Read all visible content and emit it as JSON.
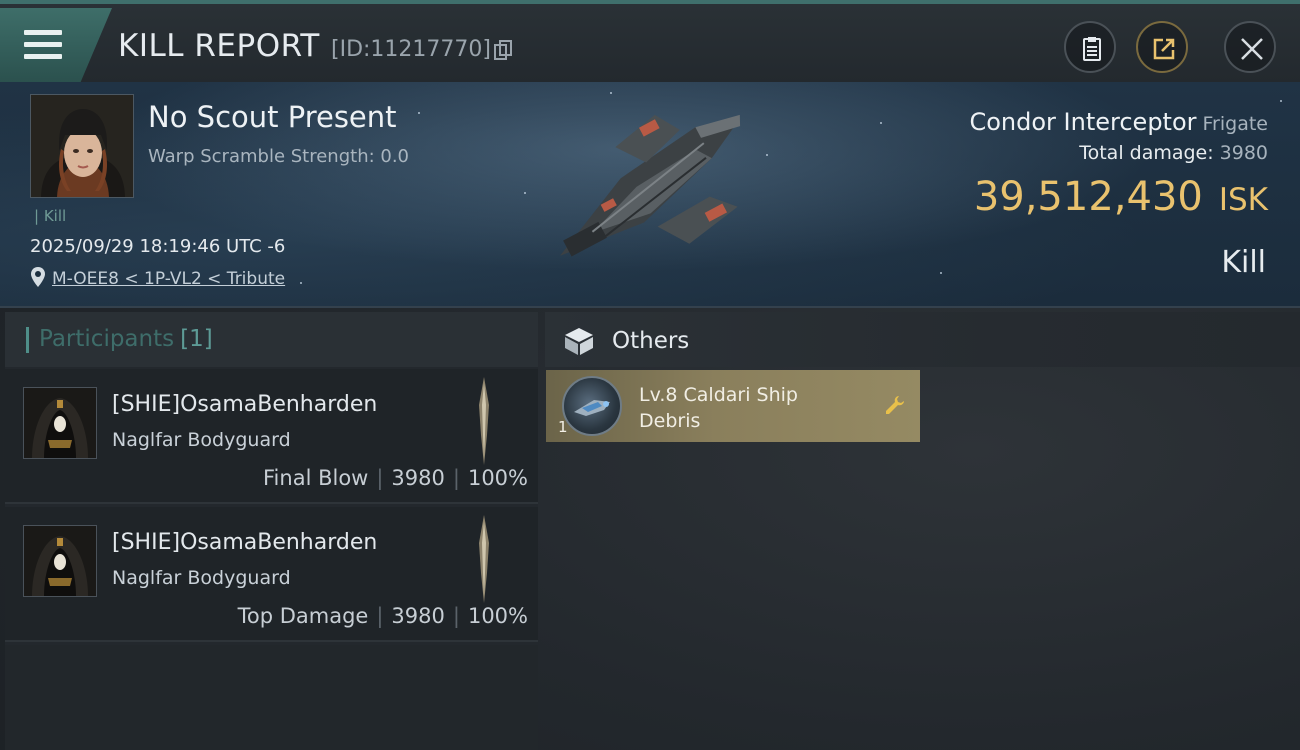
{
  "topbar": {
    "title": "KILL REPORT",
    "report_id": "[ID:11217770]",
    "icons": [
      "menu-icon",
      "copy-icon",
      "clipboard-icon",
      "share-icon",
      "close-icon"
    ]
  },
  "victim": {
    "name": "No Scout Present",
    "warp_scramble": "Warp Scramble Strength: 0.0",
    "tag": "Kill",
    "datetime": "2025/09/29 18:19:46 UTC -6",
    "location": "M-OEE8 < 1P-VL2 < Tribute"
  },
  "ship": {
    "name": "Condor Interceptor",
    "class": "Frigate",
    "total_damage_label": "Total damage:",
    "total_damage": "3980",
    "isk_value": "39,512,430",
    "isk_unit": "ISK",
    "result": "Kill"
  },
  "participants": {
    "title": "Participants",
    "count": "[1]",
    "rows": [
      {
        "name": "[SHIE]OsamaBenharden",
        "ship": "Naglfar Bodyguard",
        "role": "Final Blow",
        "damage": "3980",
        "percent": "100%"
      },
      {
        "name": "[SHIE]OsamaBenharden",
        "ship": "Naglfar Bodyguard",
        "role": "Top Damage",
        "damage": "3980",
        "percent": "100%"
      }
    ]
  },
  "others": {
    "title": "Others",
    "items": [
      {
        "name_line1": "Lv.8 Caldari Ship",
        "name_line2": "Debris",
        "qty": "1"
      }
    ]
  },
  "colors": {
    "accent_teal": "#3f6f6c",
    "isk_gold": "#e9c26e",
    "item_card_gold": "#8a7f5c"
  }
}
